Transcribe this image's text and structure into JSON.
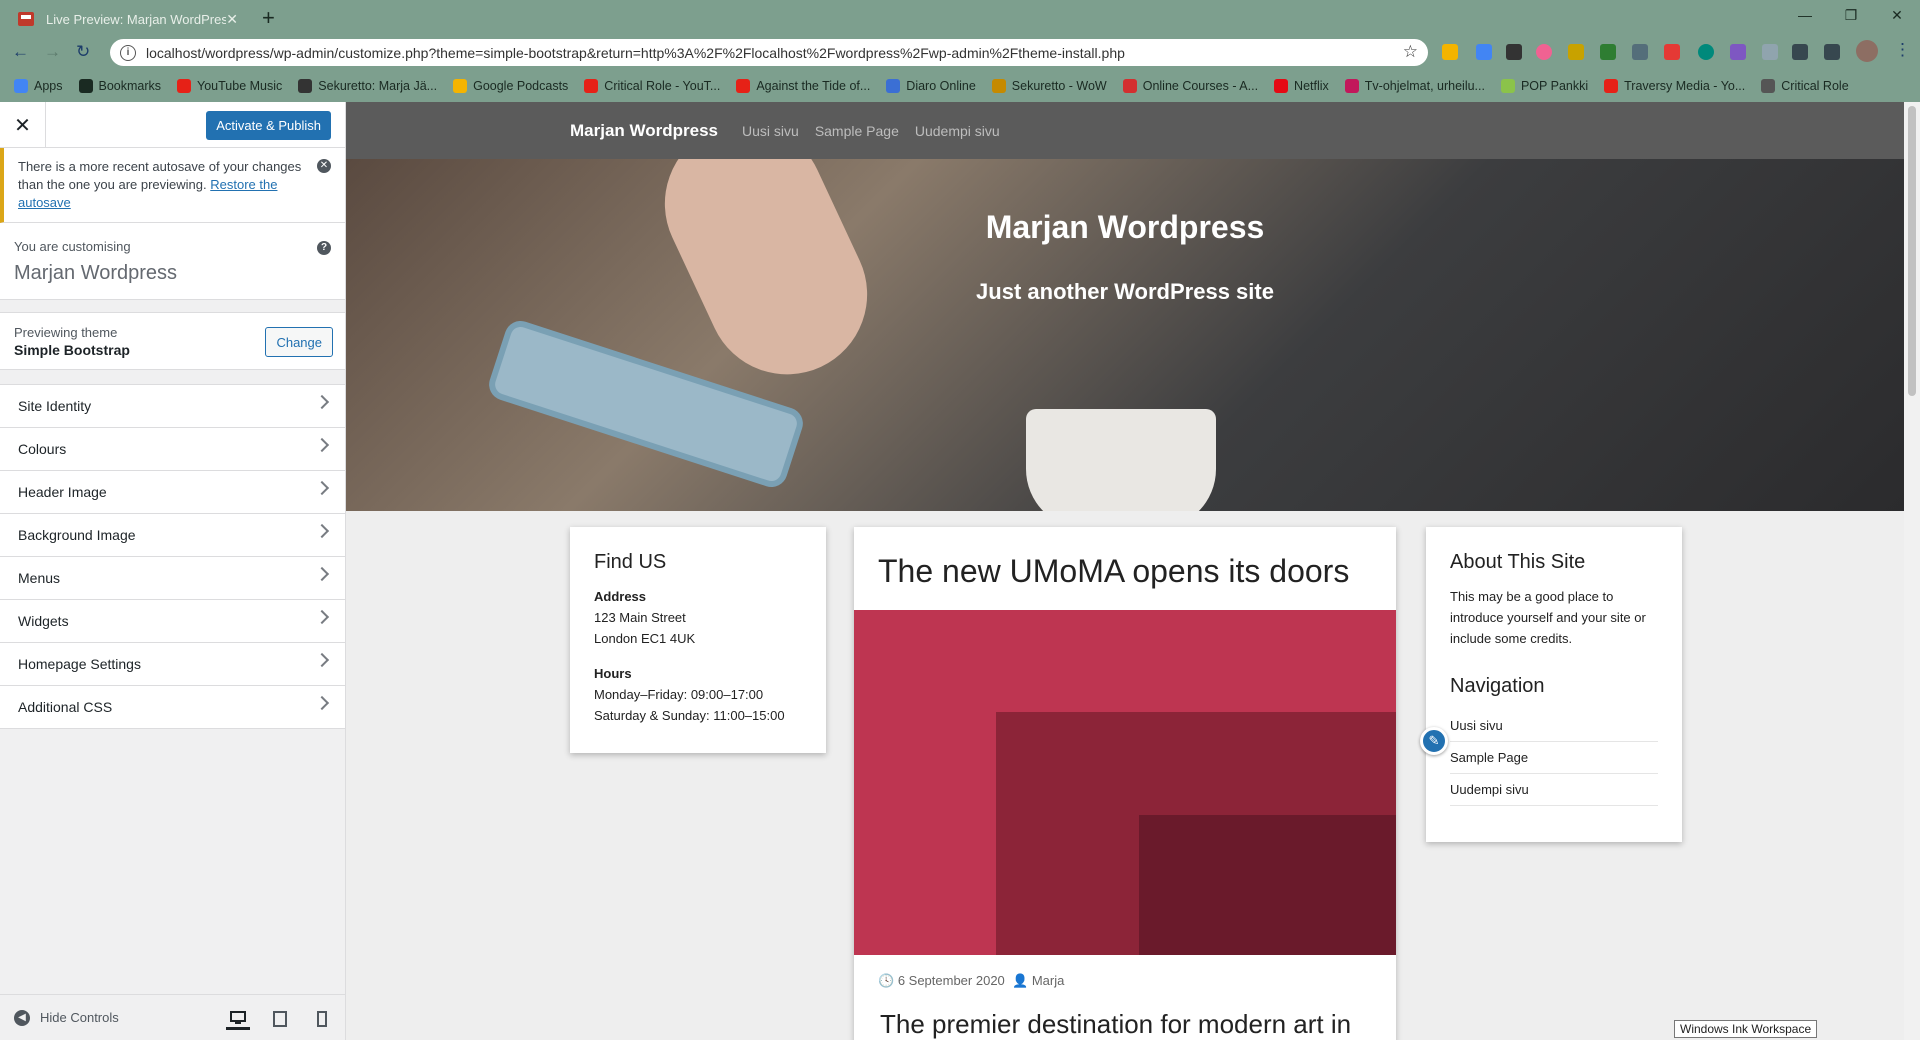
{
  "browser": {
    "tab_title": "Live Preview: Marjan WordPress",
    "url": "localhost/wordpress/wp-admin/customize.php?theme=simple-bootstrap&return=http%3A%2F%2Flocalhost%2Fwordpress%2Fwp-admin%2Ftheme-install.php",
    "bookmarks": [
      "Apps",
      "Bookmarks",
      "YouTube Music",
      "Sekuretto: Marja Jä...",
      "Google Podcasts",
      "Critical Role - YouT...",
      "Against the Tide of...",
      "Diaro Online",
      "Sekuretto - WoW",
      "Online Courses - A...",
      "Netflix",
      "Tv-ohjelmat, urheilu...",
      "POP Pankki",
      "Traversy Media - Yo...",
      "Critical Role"
    ],
    "bookmark_colors": [
      "#4285f4",
      "#1a2a22",
      "#e62117",
      "#333",
      "#f4b400",
      "#e62117",
      "#e62117",
      "#3b6fd4",
      "#c58a00",
      "#d32f2f",
      "#e50914",
      "#c2185b",
      "#8bc34a",
      "#e62117",
      "#555"
    ]
  },
  "customizer": {
    "publish_label": "Activate & Publish",
    "notice_text": "There is a more recent autosave of your changes than the one you are previewing.",
    "notice_link": "Restore the autosave",
    "customising_label": "You are customising",
    "site_name": "Marjan Wordpress",
    "previewing_label": "Previewing theme",
    "theme_name": "Simple Bootstrap",
    "change_label": "Change",
    "sections": [
      "Site Identity",
      "Colours",
      "Header Image",
      "Background Image",
      "Menus",
      "Widgets",
      "Homepage Settings",
      "Additional CSS"
    ],
    "hide_controls": "Hide Controls"
  },
  "site": {
    "brand": "Marjan Wordpress",
    "nav": [
      "Uusi sivu",
      "Sample Page",
      "Uudempi sivu"
    ],
    "hero_title": "Marjan Wordpress",
    "hero_tagline": "Just another WordPress site",
    "find": {
      "title": "Find US",
      "address_label": "Address",
      "address1": "123 Main Street",
      "address2": "London EC1 4UK",
      "hours_label": "Hours",
      "hours1": "Monday–Friday: 09:00–17:00",
      "hours2": "Saturday & Sunday: 11:00–15:00"
    },
    "post": {
      "title": "The new UMoMA opens its doors",
      "date": "6 September 2020",
      "author": "Marja",
      "subtitle": "The premier destination for modern art in"
    },
    "about": {
      "title": "About This Site",
      "text": "This may be a good place to introduce yourself and your site or include some credits.",
      "nav_title": "Navigation",
      "nav": [
        "Uusi sivu",
        "Sample Page",
        "Uudempi sivu"
      ]
    }
  },
  "tooltip": "Windows Ink Workspace"
}
